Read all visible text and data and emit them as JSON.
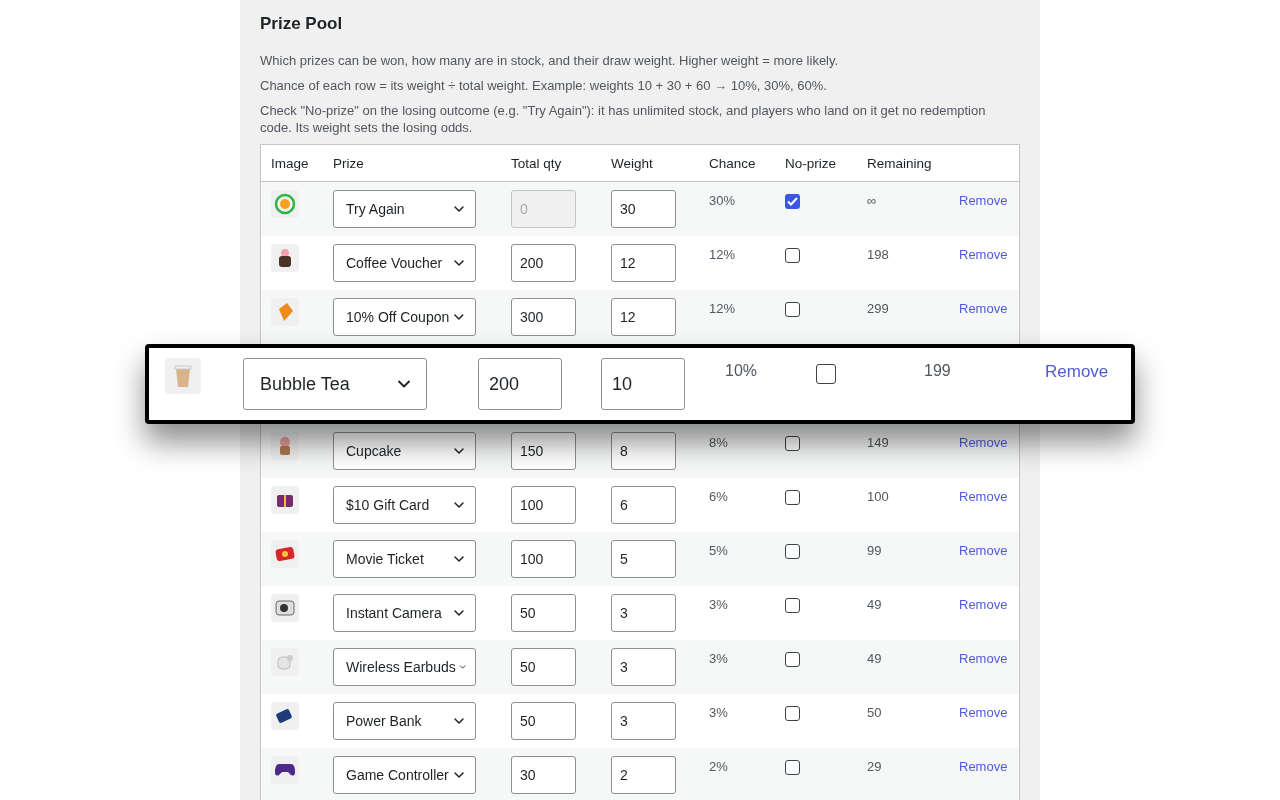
{
  "title": "Prize Pool",
  "descriptions": [
    "Which prizes can be won, how many are in stock, and their draw weight. Higher weight = more likely.",
    "Chance of each row = its weight ÷ total weight. Example: weights 10 + 30 + 60 → 10%, 30%, 60%.",
    "Check \"No-prize\" on the losing outcome (e.g. \"Try Again\"): it has unlimited stock, and players who land on it get no redemption code. Its weight sets the losing odds."
  ],
  "columns": [
    "Image",
    "Prize",
    "Total qty",
    "Weight",
    "Chance",
    "No-prize",
    "Remaining"
  ],
  "rows": [
    {
      "prize": "Try Again",
      "qty": "0",
      "qty_disabled": true,
      "weight": "30",
      "chance": "30%",
      "no_prize": true,
      "remaining": "∞",
      "action": "Remove",
      "magnified": false
    },
    {
      "prize": "Coffee Voucher",
      "qty": "200",
      "qty_disabled": false,
      "weight": "12",
      "chance": "12%",
      "no_prize": false,
      "remaining": "198",
      "action": "Remove",
      "magnified": false
    },
    {
      "prize": "10% Off Coupon",
      "qty": "300",
      "qty_disabled": false,
      "weight": "12",
      "chance": "12%",
      "no_prize": false,
      "remaining": "299",
      "action": "Remove",
      "magnified": false
    },
    {
      "prize": "Bubble Tea",
      "qty": "200",
      "qty_disabled": false,
      "weight": "10",
      "chance": "10%",
      "no_prize": false,
      "remaining": "199",
      "action": "Remove",
      "magnified": true
    },
    {
      "prize": "Cupcake",
      "qty": "150",
      "qty_disabled": false,
      "weight": "8",
      "chance": "8%",
      "no_prize": false,
      "remaining": "149",
      "action": "Remove",
      "magnified": false
    },
    {
      "prize": "$10 Gift Card",
      "qty": "100",
      "qty_disabled": false,
      "weight": "6",
      "chance": "6%",
      "no_prize": false,
      "remaining": "100",
      "action": "Remove",
      "magnified": false
    },
    {
      "prize": "Movie Ticket",
      "qty": "100",
      "qty_disabled": false,
      "weight": "5",
      "chance": "5%",
      "no_prize": false,
      "remaining": "99",
      "action": "Remove",
      "magnified": false
    },
    {
      "prize": "Instant Camera",
      "qty": "50",
      "qty_disabled": false,
      "weight": "3",
      "chance": "3%",
      "no_prize": false,
      "remaining": "49",
      "action": "Remove",
      "magnified": false
    },
    {
      "prize": "Wireless Earbuds",
      "qty": "50",
      "qty_disabled": false,
      "weight": "3",
      "chance": "3%",
      "no_prize": false,
      "remaining": "49",
      "action": "Remove",
      "magnified": false
    },
    {
      "prize": "Power Bank",
      "qty": "50",
      "qty_disabled": false,
      "weight": "3",
      "chance": "3%",
      "no_prize": false,
      "remaining": "50",
      "action": "Remove",
      "magnified": false
    },
    {
      "prize": "Game Controller",
      "qty": "30",
      "qty_disabled": false,
      "weight": "2",
      "chance": "2%",
      "no_prize": false,
      "remaining": "29",
      "action": "Remove",
      "magnified": false
    }
  ]
}
